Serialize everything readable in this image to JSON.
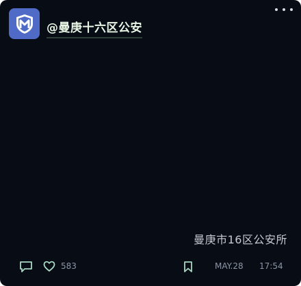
{
  "post": {
    "author_handle": "@曼庚十六区公安",
    "avatar_icon": "shield-m-icon",
    "caption": "曼庚市16区公安所",
    "like_count": "583",
    "date": "MAY.28",
    "time": "17:54"
  },
  "icons": {
    "more": "more-dots-icon",
    "comment": "comment-icon",
    "like": "heart-icon",
    "bookmark": "bookmark-icon"
  },
  "colors": {
    "background": "#080c15",
    "avatar": "#4f6bc7",
    "handle_text": "#e8f4e4",
    "icon_accent": "#a9d8c4"
  }
}
